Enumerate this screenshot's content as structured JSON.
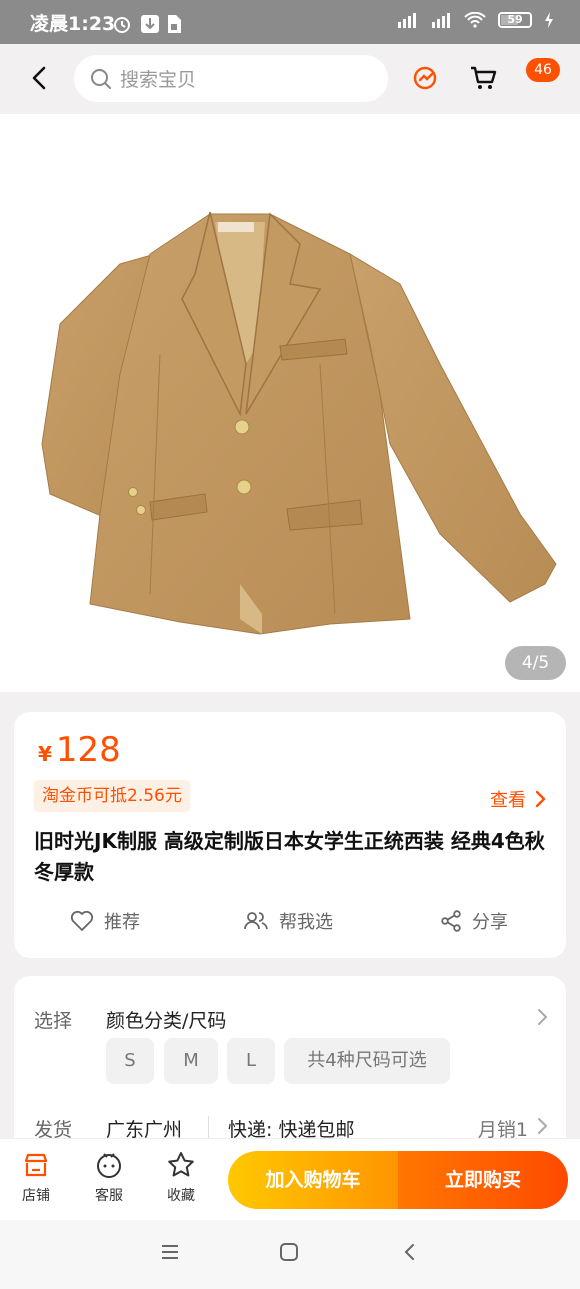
{
  "status": {
    "time": "凌晨1:23",
    "battery": "59"
  },
  "search": {
    "placeholder": "搜索宝贝"
  },
  "header": {
    "cart_badge": "46"
  },
  "gallery": {
    "counter": "4/5"
  },
  "product": {
    "currency": "¥",
    "price": "128",
    "coin_text": "淘金币可抵2.56元",
    "view_label": "查看",
    "title": "旧时光JK制服 高级定制版日本女学生正统西装 经典4色秋冬厚款"
  },
  "actions": [
    {
      "label": "推荐",
      "icon": "heart-icon"
    },
    {
      "label": "帮我选",
      "icon": "people-icon"
    },
    {
      "label": "分享",
      "icon": "share-icon"
    }
  ],
  "spec": {
    "select_label": "选择",
    "select_value": "颜色分类/尺码",
    "sizes": [
      "S",
      "M",
      "L"
    ],
    "sizes_more": "共4种尺码可选",
    "ship_label": "发货",
    "ship_from": "广东广州",
    "delivery": "快递: 快递包邮",
    "monthly_sales": "月销1"
  },
  "bottom": {
    "shop": "店铺",
    "service": "客服",
    "favorite": "收藏",
    "add_cart": "加入购物车",
    "buy_now": "立即购买"
  },
  "colors": {
    "accent": "#ff5000",
    "jacket": "#c49a63"
  }
}
